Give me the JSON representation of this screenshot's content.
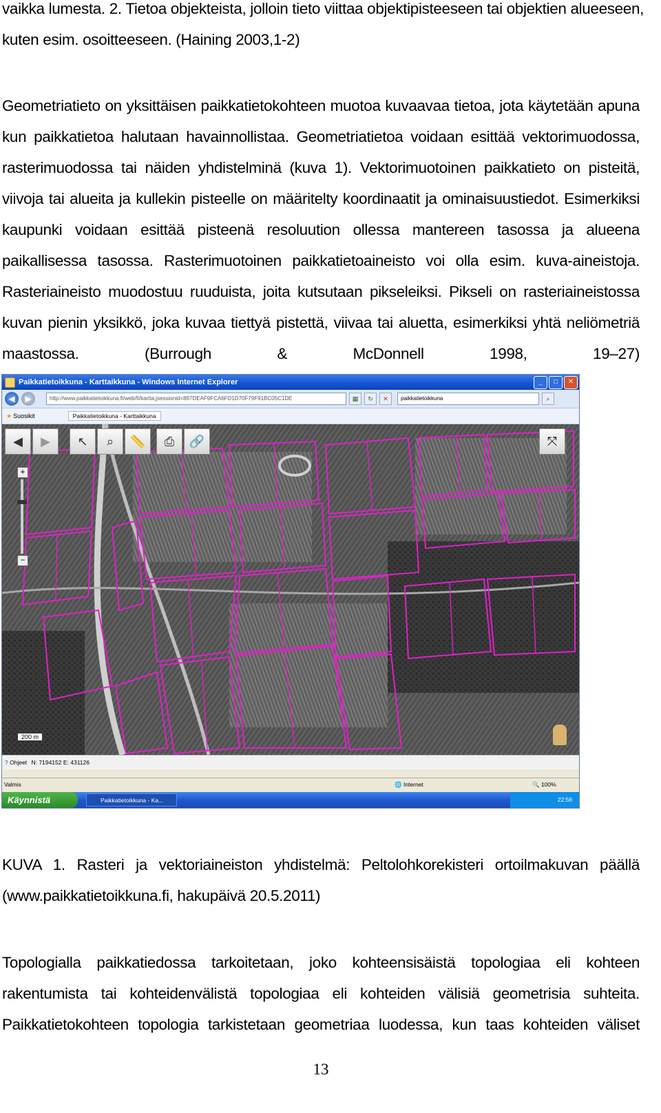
{
  "para1": {
    "lines": [
      "vaikka lumesta. 2. Tietoa objekteista, jolloin tieto viittaa objektipisteeseen tai objektien alueeseen,",
      "kuten esim. osoitteeseen. (Haining 2003,1-2)"
    ]
  },
  "para2": {
    "lines": [
      "Geometriatieto on yksittäisen paikkatietokohteen muotoa kuvaavaa tietoa, jota käytetään apuna",
      "kun paikkatietoa halutaan havainnollistaa. Geometriatietoa voidaan esittää vektorimuodossa,",
      "rasterimuodossa tai näiden yhdistelminä (kuva 1). Vektorimuotoinen paikkatieto on pisteitä,",
      "viivoja tai alueita ja kullekin pisteelle on määritelty koordinaatit ja ominaisuustiedot. Esimerkiksi",
      "kaupunki voidaan esittää pisteenä resoluution ollessa mantereen tasossa ja alueena",
      "paikallisessa tasossa. Rasterimuotoinen paikkatietoaineisto voi olla esim. kuva-aineistoja.",
      "Rasteriaineisto muodostuu ruuduista, joita kutsutaan pikseleiksi. Pikseli on rasteriaineistossa",
      "kuvan pienin yksikkö, joka kuvaa tiettyä pistettä, viivaa tai aluetta, esimerkiksi yhtä neliömetriä",
      "maastossa. (Burrough & McDonnell 1998, 19–27)"
    ]
  },
  "screenshot": {
    "window_title": "Paikkatietoikkuna - Karttaikkuna - Windows Internet Explorer",
    "url": "http://www.paikkatietoikkuna.fi/web/fi/kartta;jsessionid=897DEAF9FCA6FD1D70F79F91BC05C1DE",
    "search_text": "paikkatietoikkuna",
    "favorites_label": "Suosikit",
    "tab_label": "Paikkatietoikkuna - Karttaikkuna",
    "scale_label": "200 m",
    "status_help": "Ohjeet",
    "status_coords": "N: 7194152 E: 431126",
    "ie_status_left": "Valmis",
    "ie_status_zone": "Internet",
    "ie_zoom": "100%",
    "start_label": "Käynnistä",
    "taskbar_item": "Paikkatietoikkuna - Ka...",
    "clock": "22:56",
    "colors": {
      "parcel_outline": "#e020c8",
      "titlebar": "#1456d6",
      "taskbar": "#2158d0"
    }
  },
  "caption": {
    "lines": [
      "KUVA 1. Rasteri ja vektoriaineiston yhdistelmä: Peltolohkorekisteri ortoilmakuvan päällä",
      "(www.paikkatietoikkuna.fi, hakupäivä 20.5.2011)"
    ]
  },
  "para3": {
    "lines": [
      "Topologialla paikkatiedossa tarkoitetaan, joko kohteensisäistä topologiaa eli kohteen",
      "rakentumista tai kohteidenvälistä topologiaa eli kohteiden välisiä geometrisia suhteita.",
      "Paikkatietokohteen topologia tarkistetaan geometriaa luodessa, kun taas kohteiden väliset"
    ]
  },
  "page_number": "13"
}
